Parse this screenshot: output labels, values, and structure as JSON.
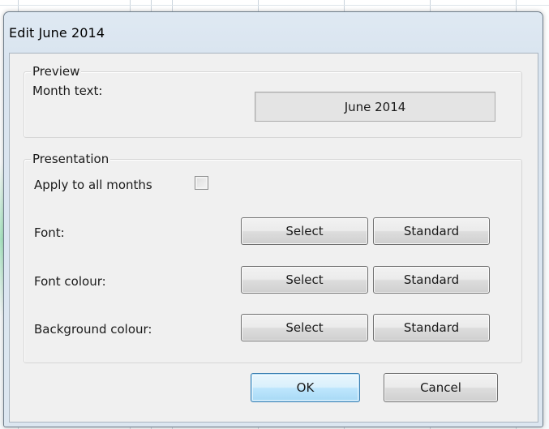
{
  "dialog": {
    "title": "Edit June 2014"
  },
  "preview": {
    "legend": "Preview",
    "month_text_label": "Month text:",
    "month_text_value": "June 2014"
  },
  "presentation": {
    "legend": "Presentation",
    "apply_all_label": "Apply to all months",
    "apply_all_checked": false,
    "rows": [
      {
        "label": "Font:",
        "select": "Select",
        "standard": "Standard"
      },
      {
        "label": "Font colour:",
        "select": "Select",
        "standard": "Standard"
      },
      {
        "label": "Background colour:",
        "select": "Select",
        "standard": "Standard"
      }
    ]
  },
  "buttons": {
    "ok": "OK",
    "cancel": "Cancel"
  },
  "colors": {
    "default_button_border": "#3c7fb1",
    "window_frame": "#dce6f0",
    "client_bg": "#f0f0f0"
  }
}
